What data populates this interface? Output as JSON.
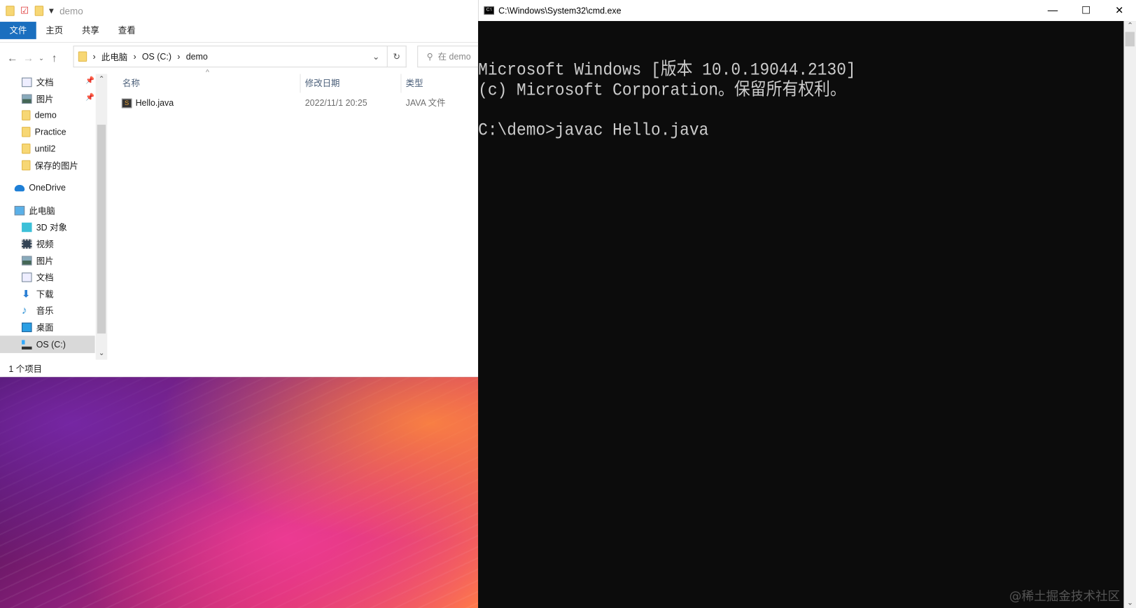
{
  "explorer": {
    "window_title": "demo",
    "ribbon_tabs": [
      "文件",
      "主页",
      "共享",
      "查看"
    ],
    "breadcrumb": [
      "此电脑",
      "OS (C:)",
      "demo"
    ],
    "search_placeholder": "在 demo",
    "sidebar": [
      {
        "label": "文档",
        "pinned": true
      },
      {
        "label": "图片",
        "pinned": true
      },
      {
        "label": "demo"
      },
      {
        "label": "Practice"
      },
      {
        "label": "until2"
      },
      {
        "label": "保存的图片"
      },
      {
        "label": "OneDrive"
      },
      {
        "label": "此电脑"
      },
      {
        "label": "3D 对象"
      },
      {
        "label": "视频"
      },
      {
        "label": "图片"
      },
      {
        "label": "文档"
      },
      {
        "label": "下载"
      },
      {
        "label": "音乐"
      },
      {
        "label": "桌面"
      },
      {
        "label": "OS (C:)",
        "selected": true
      }
    ],
    "columns": [
      "名称",
      "修改日期",
      "类型"
    ],
    "files": [
      {
        "name": "Hello.java",
        "modified": "2022/11/1 20:25",
        "type": "JAVA 文件"
      }
    ],
    "status": "1 个项目"
  },
  "cmd": {
    "title": "C:\\Windows\\System32\\cmd.exe",
    "icon_text": "C:\\",
    "lines": [
      "Microsoft Windows [版本 10.0.19044.2130]",
      "(c) Microsoft Corporation。保留所有权利。",
      "",
      "C:\\demo>javac Hello.java"
    ],
    "min": "—",
    "max": "☐",
    "close": "✕"
  },
  "watermark": "@稀土掘金技术社区",
  "colors": {
    "accent": "#1a6fbf",
    "terminal_bg": "#0c0c0c",
    "terminal_fg": "#cccccc"
  }
}
